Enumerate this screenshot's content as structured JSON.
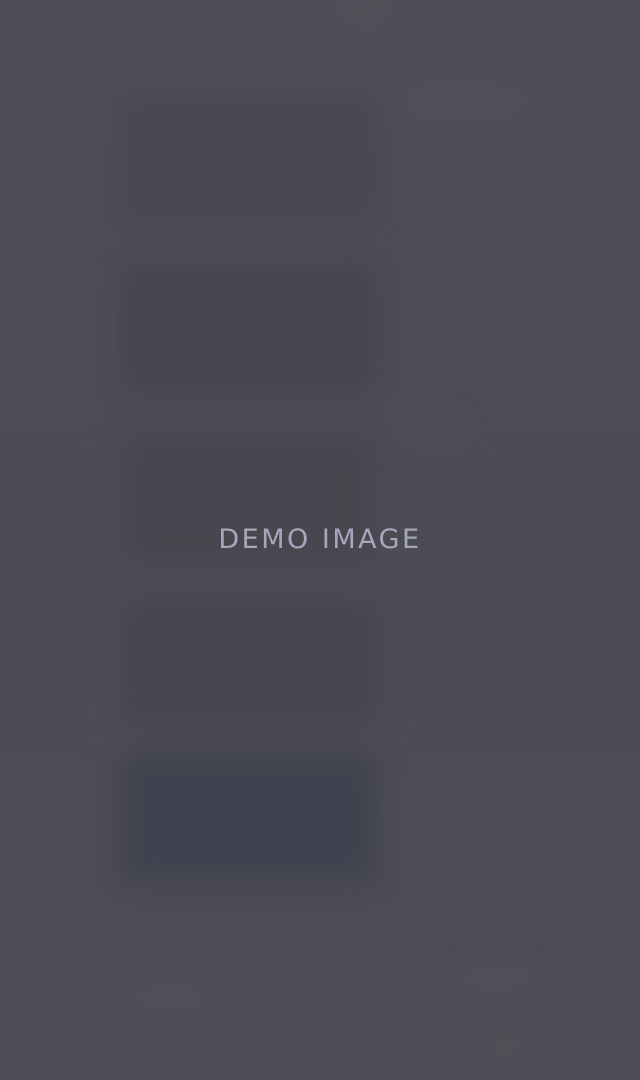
{
  "overlay": {
    "label": "DEMO IMAGE"
  },
  "colors": {
    "background": "#4e4d56",
    "label_text": "#a5a8bd",
    "placeholder_card": "#47454d",
    "placeholder_card_blue": "#40434f"
  }
}
